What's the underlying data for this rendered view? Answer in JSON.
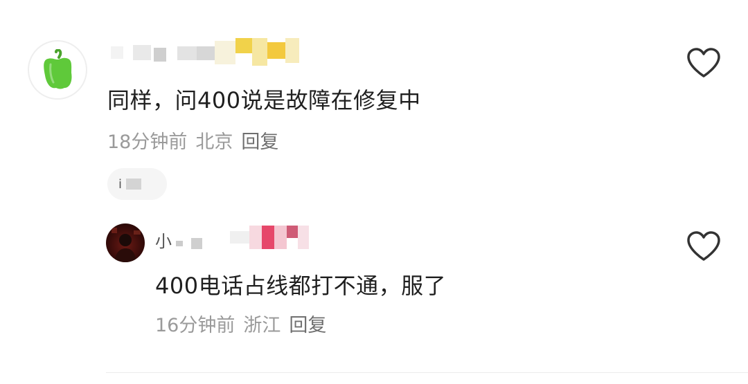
{
  "comments": [
    {
      "username": "",
      "avatar_icon": "green-pepper-icon",
      "text": "同样，问400说是故障在修复中",
      "time": "18分钟前",
      "location": "北京",
      "reply_label": "回复",
      "liked": false
    }
  ],
  "replies_chip": {
    "text": "i"
  },
  "replies": [
    {
      "username": "小",
      "avatar_icon": "dark-red-avatar",
      "text": "400电话占线都打不通，服了",
      "time": "16分钟前",
      "location": "浙江",
      "reply_label": "回复",
      "liked": false
    }
  ],
  "colors": {
    "meta_gray": "#9a9a9a",
    "text": "#1f1f1f",
    "heart_outline": "#333333",
    "pepper_green": "#5fc93a"
  }
}
